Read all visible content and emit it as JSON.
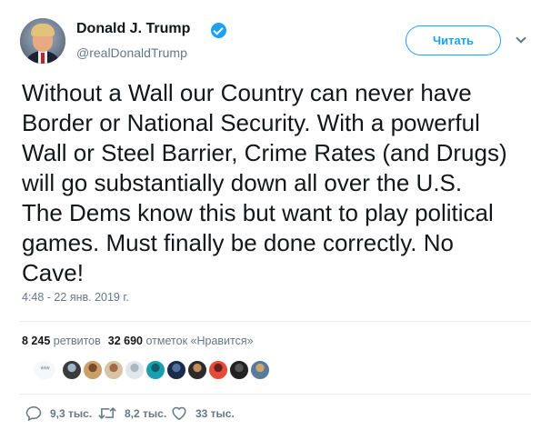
{
  "author": {
    "name": "Donald J. Trump",
    "handle": "@realDonaldTrump",
    "verified": true
  },
  "follow_button": {
    "label": "Читать"
  },
  "tweet": {
    "text": "Without a Wall our Country can never have\nBorder or National Security. With a powerful\nWall or Steel Barrier, Crime Rates (and Drugs)\nwill go substantially down all over the U.S.\nThe Dems know this but want to play political\ngames. Must finally be done correctly. No\nCave!",
    "timestamp": "4:48 - 22 янв. 2019 г."
  },
  "stats": {
    "retweets_count": "8 245",
    "retweets_label": "ретвитов",
    "likes_count": "32 690",
    "likes_label": "отметок «Нравится»"
  },
  "likers": {
    "more_label": "***",
    "avatars": [
      {
        "name": "liker-1",
        "color": "#3b3b3b",
        "accent": "#9fb7c9"
      },
      {
        "name": "liker-2",
        "color": "#c9a06a",
        "accent": "#7a4a2a"
      },
      {
        "name": "liker-3",
        "color": "#d7c4a6",
        "accent": "#a36a4a"
      },
      {
        "name": "liker-4",
        "color": "#e1e8ed",
        "accent": "#aab8c2"
      },
      {
        "name": "liker-5",
        "color": "#1a9fb0",
        "accent": "#0e5f6a"
      },
      {
        "name": "liker-6",
        "color": "#1c2b47",
        "accent": "#4f6fa3"
      },
      {
        "name": "liker-7",
        "color": "#2b2b2b",
        "accent": "#c48b5b"
      },
      {
        "name": "liker-8",
        "color": "#e24d3b",
        "accent": "#6b1f1a"
      },
      {
        "name": "liker-9",
        "color": "#222222",
        "accent": "#555555"
      },
      {
        "name": "liker-10",
        "color": "#5b7a9a",
        "accent": "#c9a86a"
      }
    ]
  },
  "actions": {
    "replies": "9,3 тыс.",
    "retweets": "8,2 тыс.",
    "likes": "33 тыс."
  },
  "colors": {
    "accent": "#1da1f2",
    "text": "#14171a",
    "secondary": "#657786",
    "divider": "#e6ecf0"
  },
  "icons": [
    "verified-badge-icon",
    "chevron-down-icon",
    "reply-icon",
    "retweet-icon",
    "like-icon"
  ]
}
